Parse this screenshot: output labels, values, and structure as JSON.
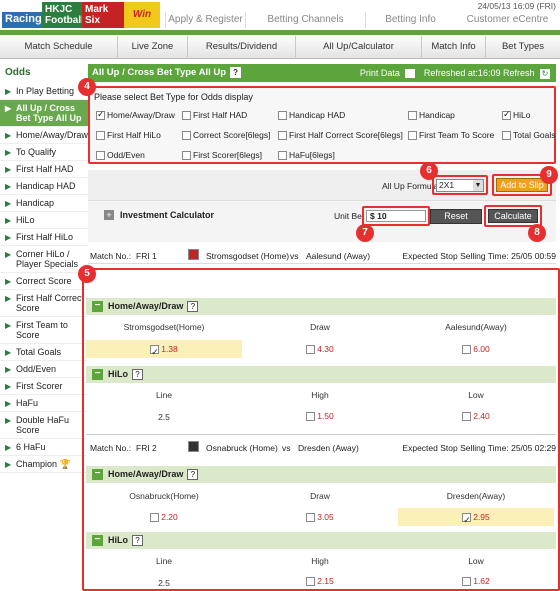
{
  "brand": {
    "racing": "Racing",
    "football_line1": "HKJC",
    "football_line2": "Football",
    "marksix_line1": "Mark",
    "marksix_line2": "Six",
    "logo_text": "Win"
  },
  "top_links": [
    "Apply & Register",
    "Betting Channels",
    "Betting Info",
    "Customer eCentre"
  ],
  "datetime": "24/05/13 16:09 (FRI)",
  "subnav": [
    "Match Schedule",
    "Live Zone",
    "Results/Dividend",
    "All Up/Calculator",
    "Match Info",
    "Bet Types"
  ],
  "sidebar": {
    "title": "Odds",
    "items": [
      "In Play Betting",
      "All Up / Cross Bet Type All Up",
      "Home/Away/Draw",
      "To Qualify",
      "First Half HAD",
      "Handicap HAD",
      "Handicap",
      "HiLo",
      "First Half HiLo",
      "Corner HiLo / Player Specials",
      "Correct Score",
      "First Half Correct Score",
      "First Team to Score",
      "Total Goals",
      "Odd/Even",
      "First Scorer",
      "HaFu",
      "Double HaFu Score",
      "6 HaFu",
      "Champion"
    ]
  },
  "header": {
    "title": "All Up / Cross Bet Type All Up",
    "help": "?",
    "print": "Print Data",
    "refreshed": "Refreshed at:16:09 Refresh"
  },
  "bet_types": {
    "prompt": "Please select Bet Type for Odds display",
    "items": [
      {
        "label": "Home/Away/Draw",
        "checked": true
      },
      {
        "label": "First Half HAD",
        "checked": false
      },
      {
        "label": "Handicap HAD",
        "checked": false
      },
      {
        "label": "Handicap",
        "checked": false
      },
      {
        "label": "HiLo",
        "checked": true
      },
      {
        "label": "First Half HiLo",
        "checked": false
      },
      {
        "label": "Correct Score[6legs]",
        "checked": false
      },
      {
        "label": "First Half Correct Score[6legs]",
        "checked": false
      },
      {
        "label": "First Team To Score",
        "checked": false
      },
      {
        "label": "Total Goals",
        "checked": false
      },
      {
        "label": "Odd/Even",
        "checked": false
      },
      {
        "label": "First Scorer[6legs]",
        "checked": false
      },
      {
        "label": "HaFu[6legs]",
        "checked": false
      }
    ]
  },
  "formula": {
    "label": "All Up Formula",
    "value": "2X1",
    "add_button": "Add to Slip"
  },
  "investment": {
    "title": "Investment Calculator",
    "unit_bet_label": "Unit Bet",
    "unit_bet_value": "$ 10",
    "reset": "Reset",
    "calculate": "Calculate"
  },
  "badges": {
    "b4": "4",
    "b5": "5",
    "b6": "6",
    "b7": "7",
    "b8": "8",
    "b9": "9"
  },
  "matches": [
    {
      "match_no_label": "Match No.:",
      "match_no": "FRI 1",
      "home": "Stromsgodset (Home)",
      "vs": "vs",
      "away": "Aalesund (Away)",
      "stop_time": "Expected Stop Selling Time: 25/05 00:59",
      "had": {
        "title": "Home/Away/Draw",
        "cols": [
          "Stromsgodset(Home)",
          "Draw",
          "Aalesund(Away)"
        ],
        "odds": [
          "1.38",
          "4.30",
          "6.00"
        ],
        "selected": 0
      },
      "hilo": {
        "title": "HiLo",
        "cols": [
          "Line",
          "High",
          "Low"
        ],
        "line": "2.5",
        "high": "1.50",
        "low": "2.40"
      }
    },
    {
      "match_no_label": "Match No.:",
      "match_no": "FRI 2",
      "home": "Osnabruck (Home)",
      "vs": "vs",
      "away": "Dresden (Away)",
      "stop_time": "Expected Stop Selling Time: 25/05 02:29",
      "had": {
        "title": "Home/Away/Draw",
        "cols": [
          "Osnabruck(Home)",
          "Draw",
          "Dresden(Away)"
        ],
        "odds": [
          "2.20",
          "3.05",
          "2.95"
        ],
        "selected": 2
      },
      "hilo": {
        "title": "HiLo",
        "cols": [
          "Line",
          "High",
          "Low"
        ],
        "line": "2.5",
        "high": "2.15",
        "low": "1.62"
      }
    }
  ]
}
